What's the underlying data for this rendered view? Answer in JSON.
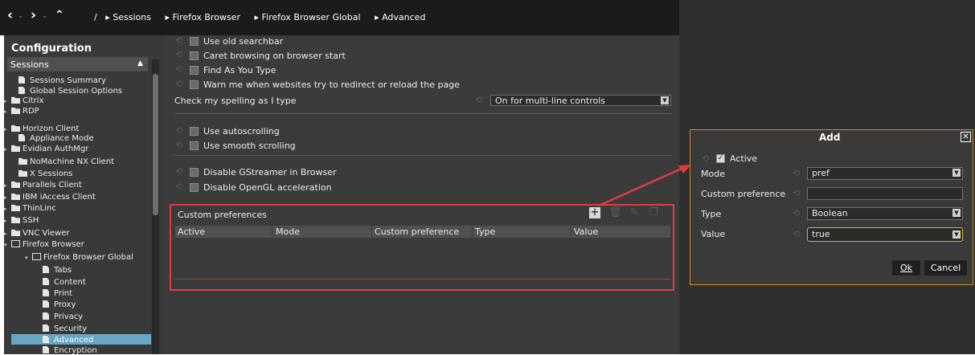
{
  "nav": {
    "back": "<",
    "forward": ">",
    "up": "^",
    "separator": "/",
    "breadcrumbs": [
      "Sessions",
      "Firefox Browser",
      "Firefox Browser Global",
      "Advanced"
    ]
  },
  "sidebar": {
    "title": "Configuration",
    "section": "Sessions",
    "items": [
      {
        "label": "Sessions Summary"
      },
      {
        "label": "Global Session Options"
      },
      {
        "label": "Citrix"
      },
      {
        "label": "RDP"
      },
      {
        "label": "Horizon Client"
      },
      {
        "label": "Appliance Mode"
      },
      {
        "label": "Evidian AuthMgr"
      },
      {
        "label": "NoMachine NX Client"
      },
      {
        "label": "X Sessions"
      },
      {
        "label": "Parallels Client"
      },
      {
        "label": "IBM iAccess Client"
      },
      {
        "label": "ThinLinc"
      },
      {
        "label": "SSH"
      },
      {
        "label": "VNC Viewer"
      },
      {
        "label": "Firefox Browser"
      },
      {
        "label": "Firefox Browser Global"
      },
      {
        "label": "Tabs"
      },
      {
        "label": "Content"
      },
      {
        "label": "Print"
      },
      {
        "label": "Proxy"
      },
      {
        "label": "Privacy"
      },
      {
        "label": "Security"
      },
      {
        "label": "Advanced"
      },
      {
        "label": "Encryption"
      }
    ]
  },
  "main": {
    "options_group1": [
      "Use old searchbar",
      "Caret browsing on browser start",
      "Find As You Type",
      "Warn me when websites try to redirect or reload the page"
    ],
    "spell_label": "Check my spelling as I type",
    "spell_value": "On for multi-line controls",
    "options_group2": [
      "Use autoscrolling",
      "Use smooth scrolling"
    ],
    "options_group3": [
      "Disable GStreamer in Browser",
      "Disable OpenGL acceleration"
    ],
    "custom_prefs": {
      "title": "Custom preferences",
      "columns": [
        "Active",
        "Mode",
        "Custom preference",
        "Type",
        "Value"
      ]
    }
  },
  "dialog": {
    "title": "Add",
    "active_label": "Active",
    "active_checked": true,
    "fields": [
      {
        "label": "Mode",
        "value": "pref"
      },
      {
        "label": "Custom preference",
        "value": ""
      },
      {
        "label": "Type",
        "value": "Boolean"
      },
      {
        "label": "Value",
        "value": "true"
      }
    ],
    "ok_label": "Ok",
    "cancel_label": "Cancel"
  },
  "colors": {
    "accent": "#e03c3c",
    "focus": "#e0b020",
    "selected": "#67a6c5"
  }
}
